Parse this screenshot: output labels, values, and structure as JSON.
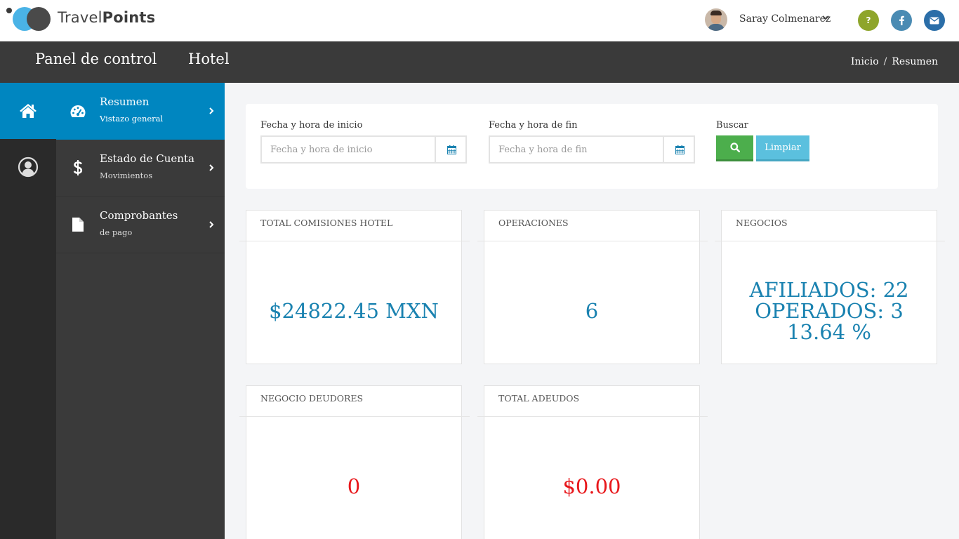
{
  "brand": {
    "word_light": "Travel",
    "word_bold": "Points"
  },
  "user": {
    "name": "Saray Colmenarez"
  },
  "social": {
    "help": "?",
    "help_color": "#8ea52b",
    "facebook_color": "#4a8bb3",
    "mail_color": "#2b6ea8"
  },
  "header": {
    "title": "Panel de control",
    "section": "Hotel",
    "breadcrumb": [
      "Inicio",
      "Resumen"
    ],
    "separator": "/"
  },
  "sidebar": {
    "accent": "#0086c0",
    "items": [
      {
        "title": "Resumen",
        "subtitle": "Vistazo general",
        "icon": "dashboard-icon",
        "active": true
      },
      {
        "title": "Estado de Cuenta",
        "subtitle": "Movimientos",
        "icon": "dollar-icon",
        "active": false
      },
      {
        "title": "Comprobantes",
        "subtitle": "de pago",
        "icon": "document-icon",
        "active": false
      }
    ]
  },
  "filter": {
    "start_label": "Fecha y hora de inicio",
    "start_placeholder": "Fecha y hora de inicio",
    "end_label": "Fecha y hora de fin",
    "end_placeholder": "Fecha y hora de fin",
    "search_label": "Buscar",
    "clear_label": "Limpiar"
  },
  "cards": {
    "commissions": {
      "title": "TOTAL COMISIONES HOTEL",
      "value": "$24822.45 MXN"
    },
    "operations": {
      "title": "OPERACIONES",
      "value": "6"
    },
    "businesses": {
      "title": "NEGOCIOS",
      "line1": "AFILIADOS: 22",
      "line2": "OPERADOS: 3",
      "line3": "13.64 %"
    },
    "debtors": {
      "title": "NEGOCIO DEUDORES",
      "value": "0"
    },
    "debts": {
      "title": "TOTAL ADEUDOS",
      "value": "$0.00"
    }
  },
  "colors": {
    "value_blue": "#1a82b0",
    "value_red": "#e8171b",
    "dark_header": "#3a3a3a"
  }
}
